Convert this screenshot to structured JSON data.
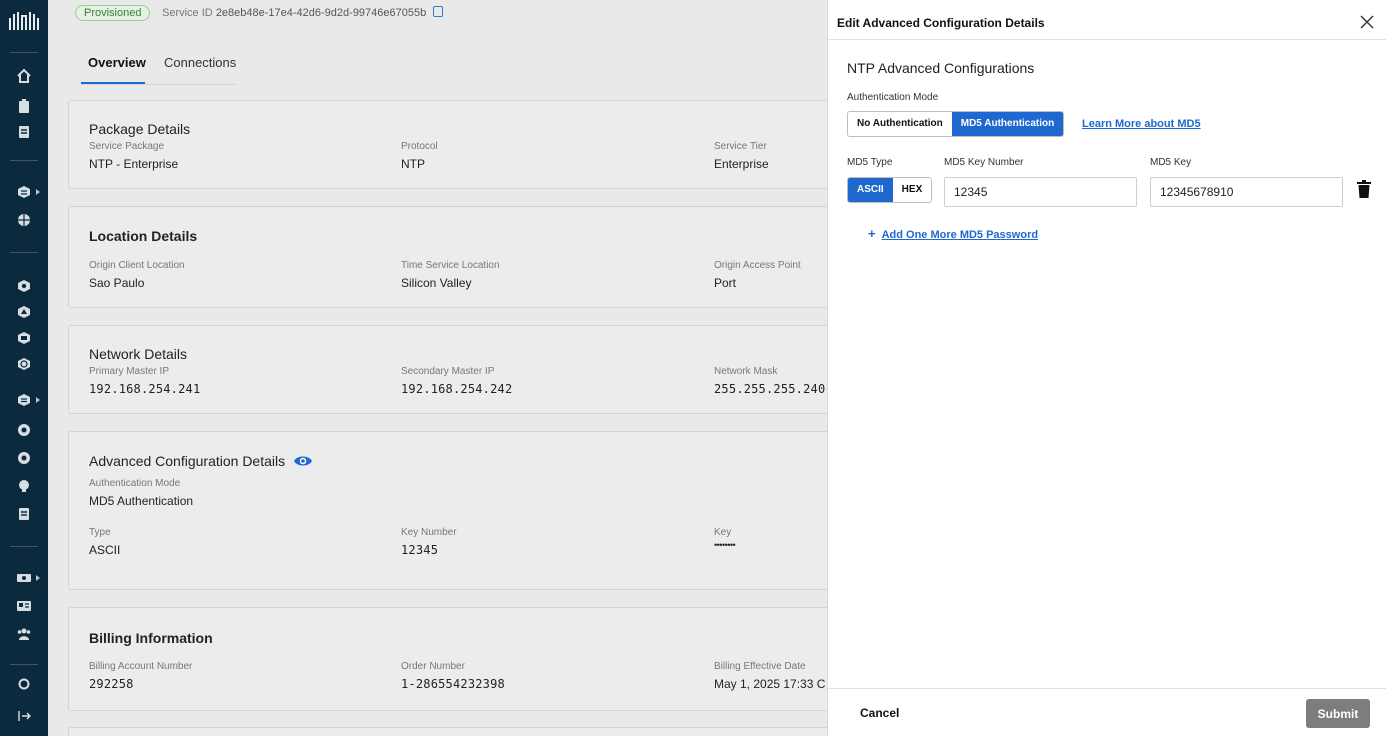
{
  "sidebar": {
    "icons": [
      "logo-icon",
      "home-icon",
      "clipboard-icon",
      "document-icon",
      "ntp-icon",
      "globe-icon",
      "service-icon",
      "fabric-icon",
      "network-icon",
      "world-icon",
      "database-icon",
      "clock-icon",
      "timer-icon",
      "bulb-icon",
      "notes-icon",
      "server-icon",
      "id-card-icon",
      "users-icon",
      "location-icon",
      "collapse-icon"
    ]
  },
  "header": {
    "status": "Provisioned",
    "service_id_label": "Service ID",
    "service_id": "2e8eb48e-17e4-42d6-9d2d-99746e67055b"
  },
  "tabs": [
    {
      "label": "Overview",
      "active": true
    },
    {
      "label": "Connections",
      "active": false
    }
  ],
  "package": {
    "title": "Package Details",
    "fields": [
      {
        "label": "Service Package",
        "value": "NTP - Enterprise"
      },
      {
        "label": "Protocol",
        "value": "NTP"
      },
      {
        "label": "Service Tier",
        "value": "Enterprise"
      }
    ]
  },
  "location": {
    "title": "Location Details",
    "fields": [
      {
        "label": "Origin Client Location",
        "value": "Sao Paulo"
      },
      {
        "label": "Time Service Location",
        "value": "Silicon Valley"
      },
      {
        "label": "Origin Access Point",
        "value": "Port"
      }
    ]
  },
  "network": {
    "title": "Network Details",
    "fields": [
      {
        "label": "Primary Master IP",
        "value": "192.168.254.241"
      },
      {
        "label": "Secondary Master IP",
        "value": "192.168.254.242"
      },
      {
        "label": "Network Mask",
        "value": "255.255.255.240"
      }
    ]
  },
  "advanced": {
    "title": "Advanced Configuration Details",
    "auth_label": "Authentication Mode",
    "auth_value": "MD5 Authentication",
    "fields": [
      {
        "label": "Type",
        "value": "ASCII"
      },
      {
        "label": "Key Number",
        "value": "12345"
      },
      {
        "label": "Key",
        "value": "••••••••"
      }
    ]
  },
  "billing": {
    "title": "Billing Information",
    "fields": [
      {
        "label": "Billing Account Number",
        "value": "292258"
      },
      {
        "label": "Order Number",
        "value": "1-286554232398"
      },
      {
        "label": "Billing Effective Date",
        "value": "May 1, 2025 17:33 C"
      }
    ]
  },
  "panel": {
    "title": "Edit Advanced Configuration Details",
    "section_title": "NTP Advanced Configurations",
    "auth_mode_label": "Authentication Mode",
    "auth_options": [
      {
        "label": "No Authentication",
        "active": false
      },
      {
        "label": "MD5 Authentication",
        "active": true
      }
    ],
    "learn_more": "Learn More about MD5",
    "md5_type_label": "MD5 Type",
    "md5_types": [
      {
        "label": "ASCII",
        "active": true
      },
      {
        "label": "HEX",
        "active": false
      }
    ],
    "key_number_label": "MD5 Key Number",
    "key_number_value": "12345",
    "key_label": "MD5 Key",
    "key_value": "12345678910",
    "add_more": "Add One More MD5 Password",
    "add_plus": "+",
    "cancel": "Cancel",
    "submit": "Submit"
  },
  "colors": {
    "rail": "#0c2a3e",
    "accent": "#1f68cf",
    "status_green": "#3c7d3a",
    "submit_disabled": "#7d7d7d"
  }
}
